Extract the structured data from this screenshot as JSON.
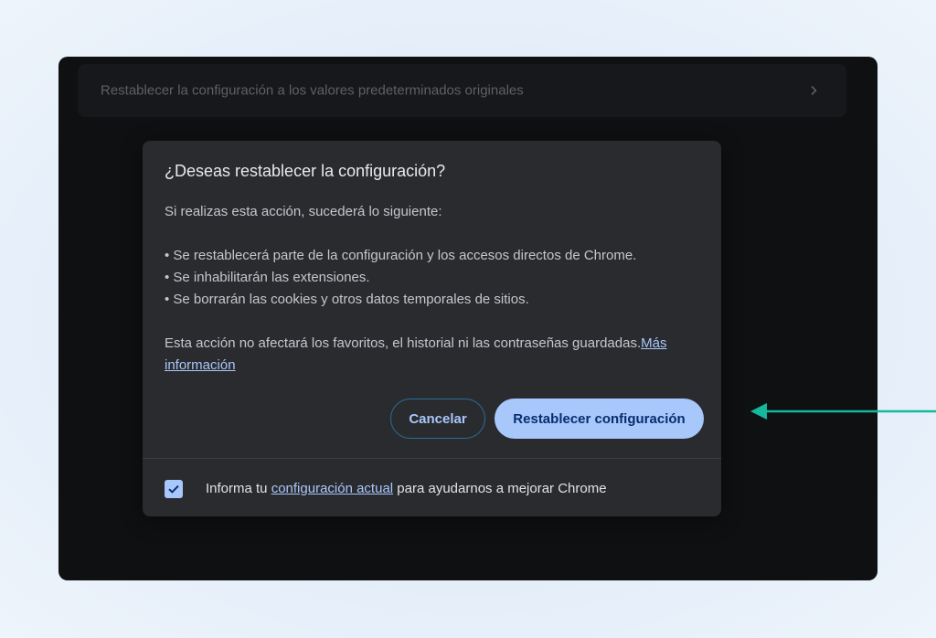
{
  "settings": {
    "reset_row_label": "Restablecer la configuración a los valores predeterminados originales"
  },
  "dialog": {
    "title": "¿Deseas restablecer la configuración?",
    "intro": "Si realizas esta acción, sucederá lo siguiente:",
    "bullets": [
      "• Se restablecerá parte de la configuración y los accesos directos de Chrome.",
      "• Se inhabilitarán las extensiones.",
      "• Se borrarán las cookies y otros datos temporales de sitios."
    ],
    "note": "Esta acción no afectará los favoritos, el historial ni las contraseñas guardadas.",
    "more_info_link": "Más información",
    "cancel_label": "Cancelar",
    "reset_label": "Restablecer configuración",
    "report": {
      "checked": true,
      "prefix": "Informa tu ",
      "link": "configuración actual",
      "suffix": " para ayudarnos a mejorar Chrome"
    }
  },
  "icons": {
    "chevron": "chevron-right-icon",
    "check": "check-icon",
    "annotation": "arrow-left-icon"
  },
  "colors": {
    "accent": "#a8c7fa",
    "annotation_arrow": "#14b89a",
    "dialog_bg": "#2a2b2f"
  }
}
